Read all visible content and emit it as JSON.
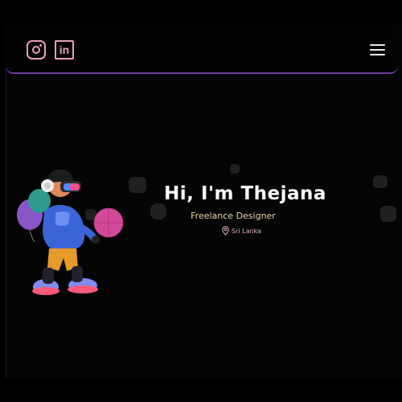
{
  "header": {
    "social": [
      {
        "name": "instagram",
        "icon": "instagram-icon"
      },
      {
        "name": "linkedin",
        "icon": "linkedin-icon",
        "label": "in"
      }
    ],
    "menu_icon": "hamburger-menu-icon"
  },
  "hero": {
    "title": "Hi, I'm Thejana",
    "subtitle": "Freelance Designer",
    "location": "Sri Lanka",
    "location_icon": "map-pin-icon"
  },
  "colors": {
    "background": "#000000",
    "accent_border": "#6b3aa0",
    "icon_pink": "#e8a0b8",
    "subtitle": "#e8d8a8"
  }
}
